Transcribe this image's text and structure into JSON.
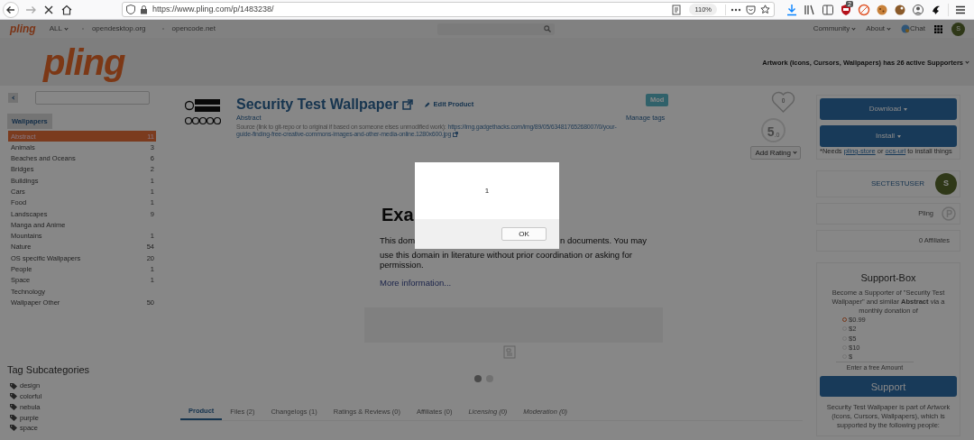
{
  "browser": {
    "url": "https://www.pling.com/p/1483238/",
    "zoom": "110%",
    "badge": "2"
  },
  "site_nav": {
    "logo": "pling",
    "menu": "ALL",
    "links": [
      "opendesktop.org",
      "opencode.net"
    ],
    "right": [
      "Community",
      "About"
    ],
    "chat": "Chat",
    "avatar": "S"
  },
  "header": {
    "logo": "pling",
    "supporters": "Artwork (Icons, Cursors, Wallpapers) has 26 active Supporters"
  },
  "sidebar": {
    "category": "Wallpapers",
    "items": [
      {
        "label": "Abstract",
        "count": "11",
        "selected": true
      },
      {
        "label": "Animals",
        "count": "3",
        "selected": false
      },
      {
        "label": "Beaches and Oceans",
        "count": "6",
        "selected": false
      },
      {
        "label": "Bridges",
        "count": "2",
        "selected": false
      },
      {
        "label": "Buildings",
        "count": "1",
        "selected": false
      },
      {
        "label": "Cars",
        "count": "1",
        "selected": false
      },
      {
        "label": "Food",
        "count": "1",
        "selected": false
      },
      {
        "label": "Landscapes",
        "count": "9",
        "selected": false
      },
      {
        "label": "Manga and Anime",
        "selected": false
      },
      {
        "label": "Mountains",
        "count": "1",
        "selected": false
      },
      {
        "label": "Nature",
        "count": "54",
        "selected": false
      },
      {
        "label": "OS specific Wallpapers",
        "count": "20",
        "selected": false
      },
      {
        "label": "People",
        "count": "1",
        "selected": false
      },
      {
        "label": "Space",
        "count": "1",
        "selected": false
      },
      {
        "label": "Technology",
        "selected": false
      },
      {
        "label": "Wallpaper Other",
        "count": "50",
        "selected": false
      }
    ],
    "tags_title": "Tag Subcategories",
    "tags": [
      "design",
      "colorful",
      "nebula",
      "purple",
      "space"
    ]
  },
  "product": {
    "title": "Security Test Wallpaper",
    "edit": "Edit Product",
    "category": "Abstract",
    "badge": "Mod",
    "manage_tags": "Manage tags",
    "source_label": "Source (link to git-repo or to original if based on someone elses unmodified work):",
    "source_url_line_1": "https://img.gadgethacks.com/img/89/05/63481765268007/0/your-",
    "source_url_line_2": "guide-finding-free-creative-commons-images-and-other-media-online.1280x600.jpg",
    "likes": "0",
    "rating": "5",
    "rating_decimal": ".0",
    "add_rating": "Add Rating"
  },
  "preview": {
    "heading": "Exa",
    "line_1_start": "This dom",
    "line_1_end": "n documents. You may",
    "line_2": "use this domain in literature without prior coordination or asking for",
    "line_3": "permission.",
    "link": "More information...",
    "slides": [
      {
        "selected": true
      },
      {
        "selected": false
      }
    ]
  },
  "tabs": [
    {
      "label": "Product",
      "selected": true,
      "italic": false
    },
    {
      "label": "Files (2)",
      "selected": false,
      "italic": false
    },
    {
      "label": "Changelogs (1)",
      "selected": false,
      "italic": false
    },
    {
      "label": "Ratings & Reviews (0)",
      "selected": false,
      "italic": false
    },
    {
      "label": "Affiliates (0)",
      "selected": false,
      "italic": false
    },
    {
      "label": "Licensing (0)",
      "selected": false,
      "italic": true
    },
    {
      "label": "Moderation (0)",
      "selected": false,
      "italic": true
    }
  ],
  "actions": {
    "download": "Download",
    "install": "Install",
    "note_start": "*Needs",
    "link_1": "pling-store",
    "note_mid": "or",
    "link_2": "ocs-url",
    "note_end": "to install things"
  },
  "user": {
    "name": "SECTESTUSER",
    "avatar": "S"
  },
  "pling": {
    "label": "Pling"
  },
  "affiliates": {
    "label": "0 Affiliates"
  },
  "support_box": {
    "title": "Support-Box",
    "text": "Become a Supporter of \"Security Test Wallpaper\" and similar **Abstract** via a monthly donation of",
    "options": [
      {
        "label": "$0.99",
        "selected": true
      },
      {
        "label": "$2",
        "selected": false
      },
      {
        "label": "$5",
        "selected": false
      },
      {
        "label": "$10",
        "selected": false
      },
      {
        "label": "$",
        "selected": false
      }
    ],
    "hint": "Enter a free Amount",
    "button": "Support",
    "footer": "Security Test Wallpaper is part of Artwork (Icons, Cursors, Wallpapers), which is supported by the following people:"
  },
  "dialog": {
    "message": "1",
    "button": "OK"
  }
}
